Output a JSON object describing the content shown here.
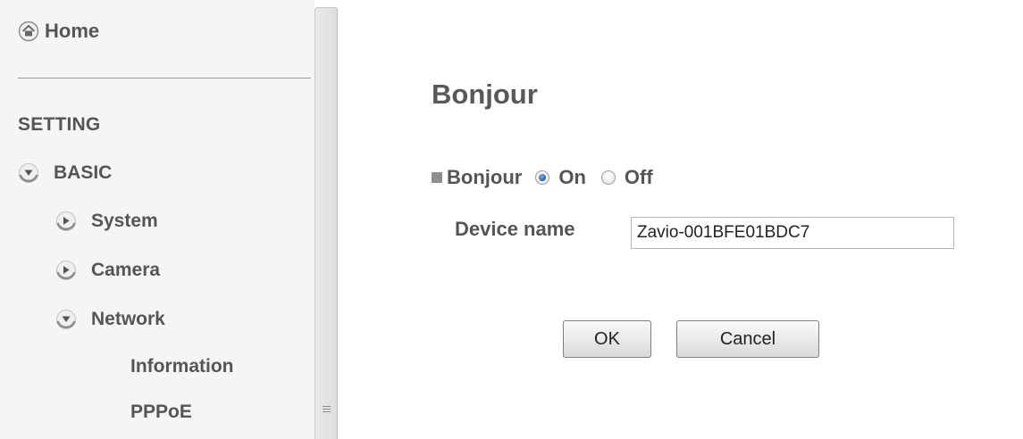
{
  "sidebar": {
    "home_label": "Home",
    "section_title": "SETTING",
    "basic_label": "BASIC",
    "system_label": "System",
    "camera_label": "Camera",
    "network_label": "Network",
    "information_label": "Information",
    "pppoe_label": "PPPoE"
  },
  "main": {
    "title": "Bonjour",
    "bonjour_label": "Bonjour",
    "on_label": "On",
    "off_label": "Off",
    "bonjour_selected": "On",
    "device_name_label": "Device name",
    "device_name_value": "Zavio-001BFE01BDC7",
    "ok_label": "OK",
    "cancel_label": "Cancel"
  }
}
